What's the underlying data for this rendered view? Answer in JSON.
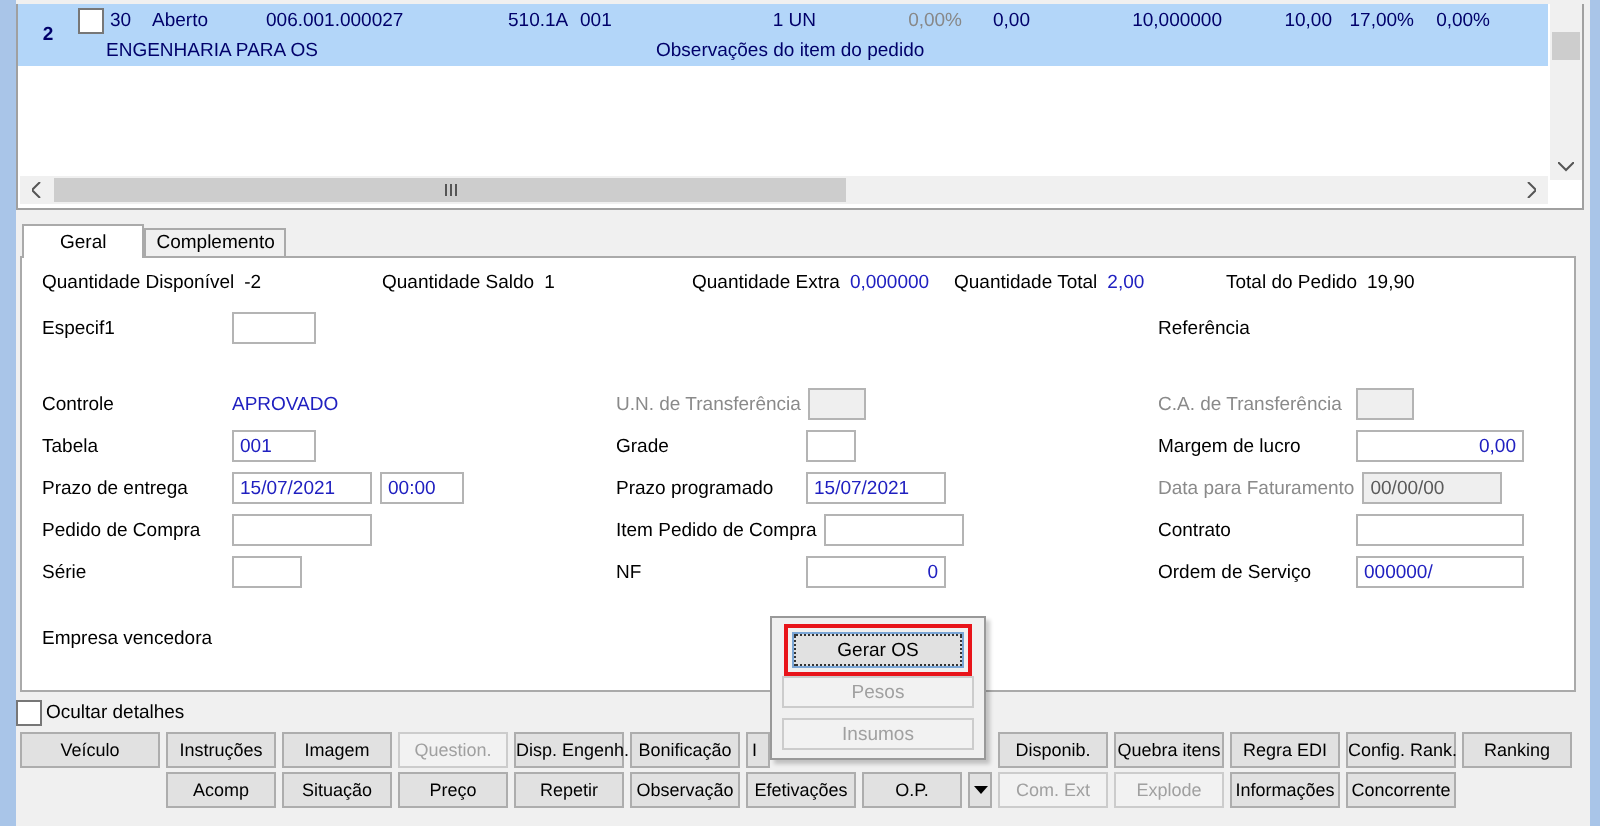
{
  "grid": {
    "rows": [
      {
        "number": "2",
        "checked": false,
        "selected": true,
        "cells": [
          {
            "text": "30",
            "muted": false
          },
          {
            "text": "Aberto",
            "muted": false
          },
          {
            "text": "006.001.000027",
            "muted": false
          },
          {
            "text": "510.1A",
            "muted": false
          },
          {
            "text": "001",
            "muted": false
          },
          {
            "text": "1 UN",
            "muted": false
          },
          {
            "text": "0,00%",
            "muted": true
          },
          {
            "text": "0,00",
            "muted": false
          },
          {
            "text": "10,000000",
            "muted": false
          },
          {
            "text": "10,00",
            "muted": false
          },
          {
            "text": "17,00%",
            "muted": false
          },
          {
            "text": "0,00%",
            "muted": false
          }
        ],
        "subline": [
          "ENGENHARIA PARA OS",
          "Observações do item do pedido"
        ]
      }
    ]
  },
  "tabs": [
    {
      "label": "Geral",
      "selected": true
    },
    {
      "label": "Complemento",
      "selected": false
    }
  ],
  "summary": [
    {
      "label": "Quantidade Disponível",
      "value": "-2",
      "blue": false
    },
    {
      "label": "Quantidade Saldo",
      "value": "1",
      "blue": false
    },
    {
      "label": "Quantidade Extra",
      "value": "0,000000",
      "blue": true
    },
    {
      "label": "Quantidade Total",
      "value": "2,00",
      "blue": true
    },
    {
      "label": "Total do Pedido",
      "value": "19,90",
      "blue": false
    }
  ],
  "form": {
    "sections": [
      [
        {
          "cells": [
            {
              "label": "Especif1",
              "disabled": false,
              "fields": [
                {
                  "kind": "short",
                  "disabled": false
                }
              ]
            },
            null,
            {
              "label": "Referência",
              "disabled": false
            }
          ]
        }
      ],
      [
        {
          "cells": [
            {
              "label": "Controle",
              "disabled": false,
              "text": "APROVADO"
            },
            {
              "label": "U.N. de Transferência",
              "disabled": true,
              "fields": [
                {
                  "kind": "small",
                  "disabled": true
                }
              ]
            },
            {
              "label": "C.A. de Transferência",
              "disabled": true,
              "fields": [
                {
                  "kind": "small",
                  "disabled": true
                }
              ]
            }
          ]
        },
        {
          "cells": [
            {
              "label": "Tabela",
              "disabled": false,
              "fields": [
                {
                  "kind": "short",
                  "value": "001",
                  "disabled": false
                }
              ]
            },
            {
              "label": "Grade",
              "disabled": false,
              "fields": [
                {
                  "kind": "tiny",
                  "disabled": false
                }
              ]
            },
            {
              "label": "Margem de lucro",
              "disabled": false,
              "fields": [
                {
                  "kind": "long-number",
                  "value": "0,00",
                  "disabled": false
                }
              ]
            }
          ]
        },
        {
          "cells": [
            {
              "label": "Prazo de entrega",
              "disabled": false,
              "fields": [
                {
                  "kind": "medium",
                  "value": "15/07/2021",
                  "disabled": false
                },
                {
                  "kind": "short",
                  "value": "00:00",
                  "disabled": false
                }
              ]
            },
            {
              "label": "Prazo programado",
              "disabled": false,
              "fields": [
                {
                  "kind": "medium",
                  "value": "15/07/2021",
                  "disabled": false
                }
              ]
            },
            {
              "label": "Data para Faturamento",
              "disabled": true,
              "fields": [
                {
                  "kind": "medium",
                  "value": "00/00/00",
                  "disabled": true
                }
              ]
            }
          ]
        },
        {
          "cells": [
            {
              "label": "Pedido de Compra",
              "disabled": false,
              "fields": [
                {
                  "kind": "medium",
                  "disabled": false
                }
              ]
            },
            {
              "label": "Item Pedido de Compra",
              "disabled": false,
              "fields": [
                {
                  "kind": "medium",
                  "disabled": false
                }
              ]
            },
            {
              "label": "Contrato",
              "disabled": false,
              "fields": [
                {
                  "kind": "long",
                  "disabled": false
                }
              ]
            }
          ]
        },
        {
          "cells": [
            {
              "label": "Série",
              "disabled": false,
              "fields": [
                {
                  "kind": "narrow",
                  "disabled": false
                }
              ]
            },
            {
              "label": "NF",
              "disabled": false,
              "fields": [
                {
                  "kind": "medium-number",
                  "value": "0",
                  "disabled": false
                }
              ]
            },
            {
              "label": "Ordem de Serviço",
              "disabled": false,
              "fields": [
                {
                  "kind": "long",
                  "value": "000000/",
                  "disabled": false
                }
              ]
            }
          ]
        }
      ],
      [
        {
          "cells": [
            {
              "label": "Empresa vencedora",
              "disabled": false
            },
            null,
            null
          ]
        }
      ]
    ]
  },
  "hide_details": {
    "label": "Ocultar detalhes",
    "checked": false
  },
  "button_rows": [
    [
      {
        "kind": "button",
        "label": "Veículo",
        "disabled": false
      },
      {
        "kind": "button",
        "label": "Instruções",
        "disabled": false
      },
      {
        "kind": "button",
        "label": "Imagem",
        "disabled": false
      },
      {
        "kind": "button",
        "label": "Question.",
        "disabled": true
      },
      {
        "kind": "button",
        "label": "Disp. Engenh.",
        "disabled": false
      },
      {
        "kind": "button",
        "label": "Bonificação",
        "disabled": false
      },
      {
        "kind": "partial",
        "label": "I",
        "disabled": false
      },
      {
        "kind": "button",
        "label": "Disponib.",
        "disabled": false
      },
      {
        "kind": "button",
        "label": "Quebra itens",
        "disabled": false
      },
      {
        "kind": "button",
        "label": "Regra EDI",
        "disabled": false
      },
      {
        "kind": "button",
        "label": "Config. Rank.",
        "disabled": false
      },
      {
        "kind": "button",
        "label": "Ranking",
        "disabled": false
      }
    ],
    [
      {
        "kind": "button",
        "label": "Acomp",
        "disabled": false
      },
      {
        "kind": "button",
        "label": "Situação",
        "disabled": false
      },
      {
        "kind": "button",
        "label": "Preço",
        "disabled": false
      },
      {
        "kind": "button",
        "label": "Repetir",
        "disabled": false
      },
      {
        "kind": "button",
        "label": "Observação",
        "disabled": false
      },
      {
        "kind": "button",
        "label": "Efetivações",
        "disabled": false
      },
      {
        "kind": "split",
        "label": "O.P.",
        "disabled": false
      },
      {
        "kind": "dropdown",
        "disabled": false
      },
      {
        "kind": "button",
        "label": "Com. Ext",
        "disabled": true
      },
      {
        "kind": "button",
        "label": "Explode",
        "disabled": true
      },
      {
        "kind": "button",
        "label": "Informações",
        "disabled": false
      },
      {
        "kind": "button",
        "label": "Concorrente",
        "disabled": false
      }
    ]
  ],
  "popup_menu": {
    "items": [
      {
        "label": "Gerar OS",
        "disabled": false,
        "highlighted": true
      },
      {
        "label": "Pesos",
        "disabled": true,
        "highlighted": false
      },
      {
        "label": "Insumos",
        "disabled": true,
        "highlighted": false
      }
    ]
  }
}
